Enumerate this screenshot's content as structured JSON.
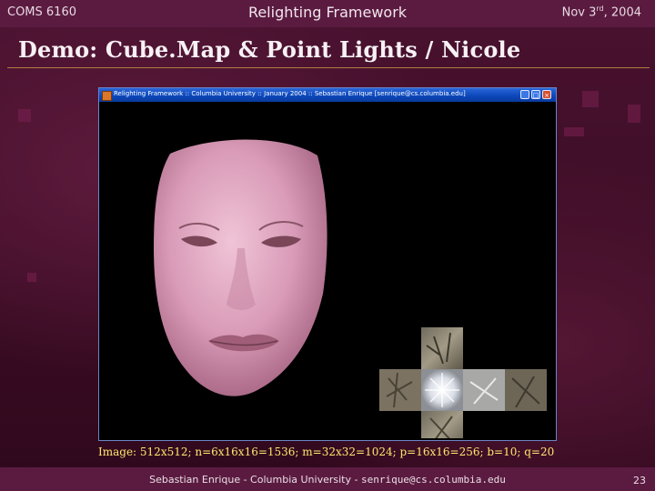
{
  "header": {
    "course": "COMS 6160",
    "title": "Relighting Framework",
    "date_prefix": "Nov 3",
    "date_sup": "rd",
    "date_suffix": ", 2004"
  },
  "slide": {
    "title": "Demo: Cube.Map & Point Lights / Nicole",
    "caption": "Image: 512x512; n=6x16x16=1536; m=32x32=1024; p=16x16=256; b=10; q=20"
  },
  "window": {
    "title": "Relighting Framework :: Columbia University :: January 2004 :: Sebastian Enrique [senrique@cs.columbia.edu]",
    "minimize_label": "_",
    "maximize_label": "□",
    "close_label": "×"
  },
  "footer": {
    "text_prefix": "Sebastian Enrique - Columbia University - ",
    "email": "senrique@cs.columbia.edu",
    "page_number": "23"
  },
  "colors": {
    "background": "#3b0d24",
    "bar": "#5b1b41",
    "caption": "#ffe66e",
    "rule": "#b07d3f"
  }
}
